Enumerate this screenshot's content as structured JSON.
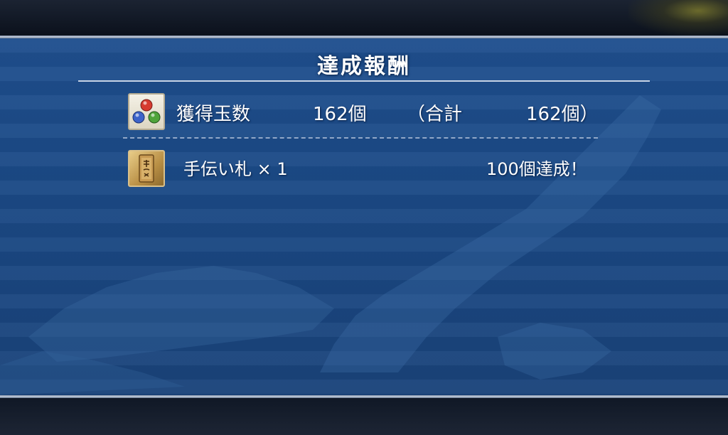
{
  "title": "達成報酬",
  "orbs_row": {
    "icon": "three-orbs-icon",
    "label": "獲得玉数",
    "count": "162個",
    "total_open": "（合計",
    "total_value": "162個）"
  },
  "reward_row": {
    "icon": "helper-tag-icon",
    "item_name": "手伝い札 × 1",
    "achievement": "100個達成！"
  },
  "colors": {
    "panel_blue": "#1d4b88",
    "frame_silver": "#c9d3e2",
    "text": "#ffffff"
  }
}
